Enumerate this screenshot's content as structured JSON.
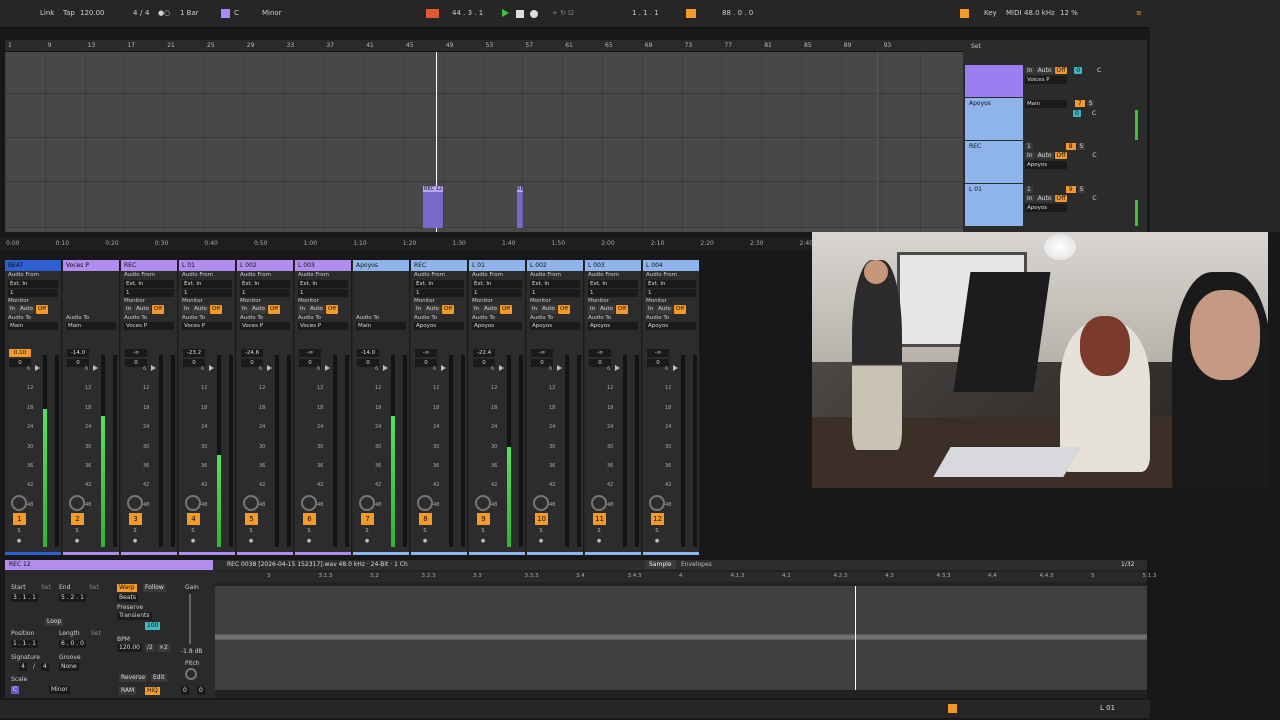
{
  "transport": {
    "link": "Link",
    "tap": "Tap",
    "tempo": "120.00",
    "signature_num": "4",
    "signature_sep": "/",
    "signature_den": "4",
    "metronome": "●○",
    "quantize": "1 Bar",
    "key_label": "C",
    "scale_label": "Minor",
    "position": "44 .  3 .  1",
    "loop_start": "1 .  1 .  1",
    "loop_len": "88 .  0 .  0",
    "key_btn": "Key",
    "midi_btn": "MIDI",
    "sample_rate": "48.0 kHz",
    "cpu": "12 %"
  },
  "ruler": {
    "bars": [
      "1",
      "9",
      "13",
      "17",
      "21",
      "25",
      "29",
      "33",
      "37",
      "41",
      "45",
      "49",
      "53",
      "57",
      "61",
      "65",
      "69",
      "73",
      "77",
      "81",
      "85",
      "89",
      "93"
    ],
    "set_label": "Set"
  },
  "arrangement": {
    "tracks": [
      {
        "name": "",
        "color": "#9b7ef0"
      },
      {
        "name": "Apoyos",
        "color": "#8fb4ec"
      },
      {
        "name": "REC",
        "color": "#8fb4ec"
      },
      {
        "name": "L 01",
        "color": "#8fb4ec"
      }
    ],
    "io": [
      {
        "input": "Voices P",
        "num": "",
        "extra": "C"
      },
      {
        "input": "Main",
        "num": "7",
        "extra": "C"
      },
      {
        "input": "Apoyos",
        "num": "8",
        "extra": "C"
      },
      {
        "input": "Apoyos",
        "num": "9",
        "extra": "C"
      }
    ],
    "clips": [
      {
        "label": "REC 12"
      },
      {
        "label": "RE"
      }
    ]
  },
  "timeline": {
    "marks": [
      "0:00",
      "0:10",
      "0:20",
      "0:30",
      "0:40",
      "0:50",
      "1:00",
      "1:10",
      "1:20",
      "1:30",
      "1:40",
      "1:50",
      "2:00",
      "2:10",
      "2:20",
      "2:30",
      "2:40"
    ]
  },
  "mixer": {
    "labels": {
      "audio_from": "Audio From",
      "ext_in": "Ext. In",
      "monitor": "Monitor",
      "in": "In",
      "auto": "Auto",
      "off": "Off",
      "audio_to": "Audio To"
    },
    "strips": [
      {
        "name": "BEAT",
        "color": "#2f5fd0",
        "dest": "Main",
        "vol": "0.10",
        "pan": "0",
        "meter": 0.72,
        "num": "1",
        "has_input": true,
        "vol_orange": true
      },
      {
        "name": "Voces P",
        "color": "#b18df0",
        "dest": "Main",
        "vol": "-14.0",
        "pan": "0",
        "meter": 0.68,
        "num": "2",
        "has_input": false
      },
      {
        "name": "REC",
        "color": "#b18df0",
        "dest": "Voces P",
        "vol": "-∞",
        "pan": "0",
        "meter": 0,
        "num": "3",
        "has_input": true
      },
      {
        "name": "L 01",
        "color": "#b18df0",
        "dest": "Voces P",
        "vol": "-23.2",
        "pan": "0",
        "meter": 0.48,
        "num": "4",
        "has_input": true
      },
      {
        "name": "L 002",
        "color": "#b18df0",
        "dest": "Voces P",
        "vol": "-24.6",
        "pan": "0",
        "meter": 0,
        "num": "5",
        "has_input": true
      },
      {
        "name": "L 003",
        "color": "#b18df0",
        "dest": "Voces P",
        "vol": "-∞",
        "pan": "0",
        "meter": 0,
        "num": "6",
        "has_input": true
      },
      {
        "name": "Apoyos",
        "color": "#8fb4ec",
        "dest": "Main",
        "vol": "-14.0",
        "pan": "0",
        "meter": 0.68,
        "num": "7",
        "has_input": false
      },
      {
        "name": "REC",
        "color": "#8fb4ec",
        "dest": "Apoyos",
        "vol": "-∞",
        "pan": "0",
        "meter": 0,
        "num": "8",
        "has_input": true
      },
      {
        "name": "L 01",
        "color": "#8fb4ec",
        "dest": "Apoyos",
        "vol": "-22.4",
        "pan": "0",
        "meter": 0.52,
        "num": "9",
        "has_input": true
      },
      {
        "name": "L 002",
        "color": "#8fb4ec",
        "dest": "Apoyos",
        "vol": "-∞",
        "pan": "0",
        "meter": 0,
        "num": "10",
        "has_input": true
      },
      {
        "name": "L 003",
        "color": "#8fb4ec",
        "dest": "Apoyos",
        "vol": "-∞",
        "pan": "0",
        "meter": 0,
        "num": "11",
        "has_input": true
      },
      {
        "name": "L 004",
        "color": "#8fb4ec",
        "dest": "Apoyos",
        "vol": "-∞",
        "pan": "0",
        "meter": 0,
        "num": "12",
        "has_input": true
      }
    ],
    "scale_marks": [
      "6",
      "0",
      "6",
      "12",
      "18",
      "24",
      "30",
      "36",
      "42",
      "48",
      "54",
      "60"
    ]
  },
  "clip": {
    "title": "REC 12",
    "file": "REC 0038 [2026-04-15 152317].wav  48.0 kHz · 24-Bit · 1 Ch",
    "tab_sample": "Sample",
    "tab_envelopes": "Envelopes",
    "page": "1/32",
    "start": "Start",
    "start_val": "3 .  1 .  1",
    "set": "Set",
    "end": "End",
    "end_val": "5 .  2 .  1",
    "loop": "Loop",
    "position": "Position",
    "position_val": "1 .  1 .  1",
    "length": "Length",
    "length_val": "6 .  0 .  0",
    "signature": "Signature",
    "sig_num": "4",
    "sig_den": "4",
    "groove": "Groove",
    "groove_val": "None",
    "scale": "Scale",
    "scale_key": "C",
    "scale_mode": "Minor",
    "warp": "Warp",
    "follow": "Follow",
    "warp_mode": "Beats",
    "preserve": "Preserve",
    "transients": "Transients",
    "amount": "100",
    "bpm": "BPM",
    "bpm_val": "120.00",
    "half": "/2",
    "double": "×2",
    "reverse": "Reverse",
    "edit": "Edit",
    "ram": "RAM",
    "hiq": "HiQ",
    "gain": "Gain",
    "gain_val": "-1.8 dB",
    "pitch": "Pitch",
    "pitch_st": "0",
    "pitch_ct": "0",
    "ruler_marks": [
      "3",
      "3.1.3",
      "3.2",
      "3.2.3",
      "3.3",
      "3.3.3",
      "3.4",
      "3.4.3",
      "4",
      "4.1.3",
      "4.2",
      "4.2.3",
      "4.3",
      "4.3.3",
      "4.4",
      "4.4.3",
      "5",
      "5.1.3"
    ]
  },
  "status": {
    "track": "L 01"
  },
  "colors": {
    "accent": "#f29a2a",
    "meter": "#3ec23e",
    "purple": "#b18df0",
    "blue": "#8fb4ec"
  }
}
